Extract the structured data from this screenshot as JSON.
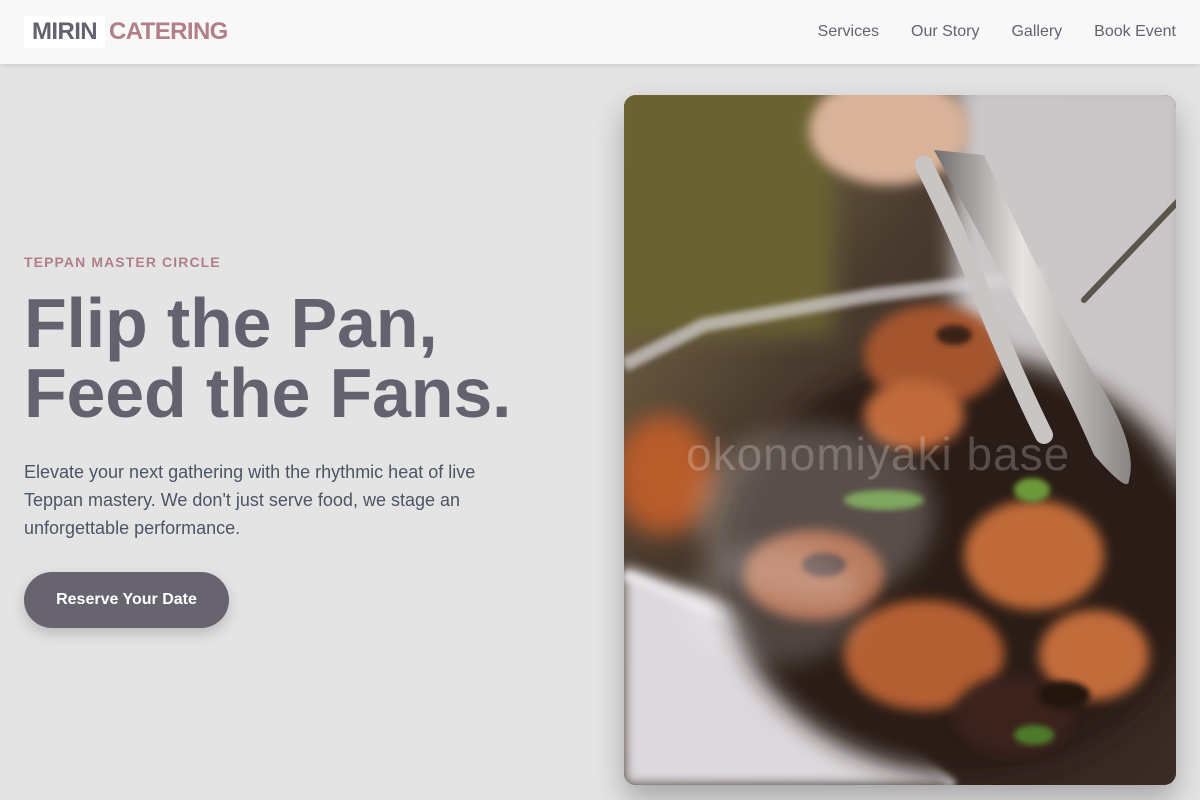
{
  "header": {
    "logo_word_1": "MIRIN",
    "logo_word_2": "CATERING",
    "nav": [
      {
        "label": "Services"
      },
      {
        "label": "Our Story"
      },
      {
        "label": "Gallery"
      },
      {
        "label": "Book Event"
      }
    ]
  },
  "hero": {
    "eyebrow": "TEPPAN MASTER CIRCLE",
    "headline_line_1": "Flip the Pan,",
    "headline_line_2": "Feed the Fans.",
    "description": "Elevate your next gathering with the rhythmic heat of live Teppan mastery. We don't just serve food, we stage an unforgettable performance.",
    "cta_label": "Reserve Your Date"
  },
  "photo": {
    "watermark": "okonomiyaki base",
    "subject": "tongs serving grilled chicken from a steaming tray"
  },
  "colors": {
    "background": "#e5e4e5",
    "accent": "#b07f88",
    "text": "#65626f",
    "button": "#67636f"
  }
}
